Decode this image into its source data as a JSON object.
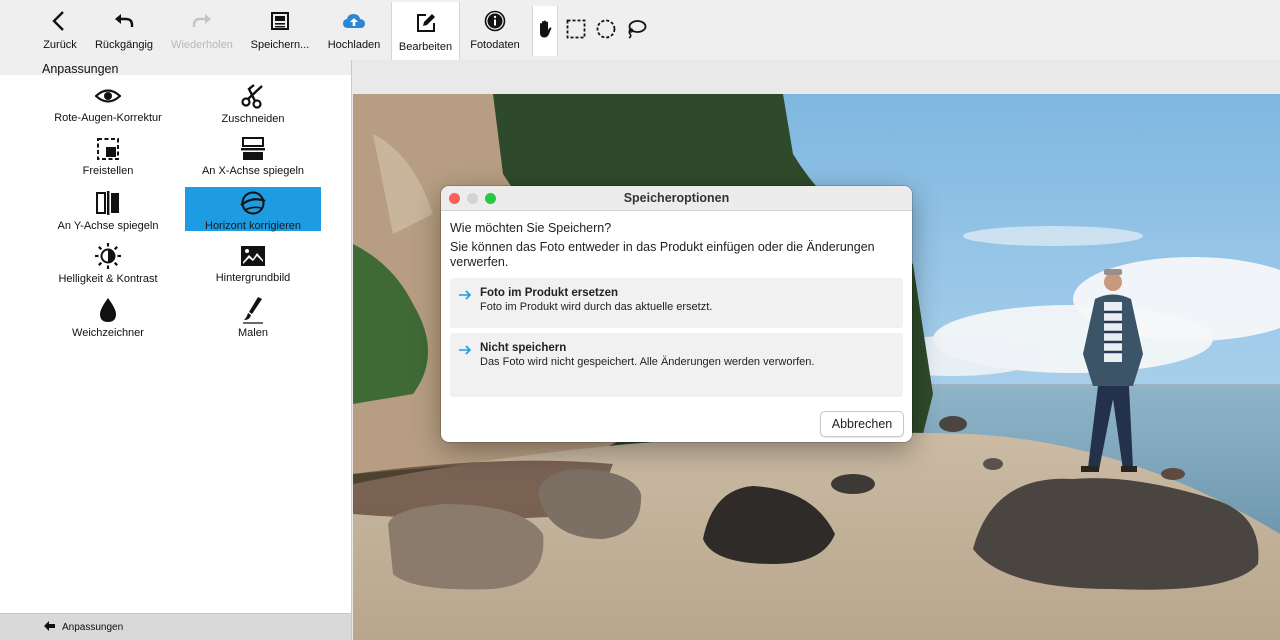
{
  "toolbar": {
    "buttons": [
      {
        "label": "Zurück",
        "icon": "chevron-left-icon"
      },
      {
        "label": "Rückgängig",
        "icon": "undo-icon"
      },
      {
        "label": "Wiederholen",
        "icon": "redo-icon"
      },
      {
        "label": "Speichern...",
        "icon": "save-icon"
      },
      {
        "label": "Hochladen",
        "icon": "cloud-upload-icon"
      },
      {
        "label": "Bearbeiten",
        "icon": "edit-icon"
      },
      {
        "label": "Fotodaten",
        "icon": "info-icon"
      }
    ],
    "tools": [
      "hand-tool-icon",
      "rect-select-icon",
      "ellipse-select-icon",
      "lasso-icon"
    ]
  },
  "panel": {
    "title": "Anpassungen",
    "items": [
      {
        "label": "Rote-Augen-Korrektur",
        "icon": "eye-icon"
      },
      {
        "label": "Zuschneiden",
        "icon": "scissors-icon"
      },
      {
        "label": "Freistellen",
        "icon": "crop-icon"
      },
      {
        "label": "An X-Achse spiegeln",
        "icon": "flip-x-icon"
      },
      {
        "label": "An Y-Achse spiegeln",
        "icon": "flip-y-icon"
      },
      {
        "label": "Horizont korrigieren",
        "icon": "horizon-icon"
      },
      {
        "label": "Helligkeit & Kontrast",
        "icon": "brightness-icon"
      },
      {
        "label": "Hintergrundbild",
        "icon": "image-icon"
      },
      {
        "label": "Weichzeichner",
        "icon": "drop-icon"
      },
      {
        "label": "Malen",
        "icon": "brush-icon"
      }
    ],
    "selected": "Horizont korrigieren",
    "footer_label": "Anpassungen"
  },
  "dialog": {
    "title": "Speicheroptionen",
    "question": "Wie möchten Sie Speichern?",
    "description": "Sie können das Foto entweder in das Produkt einfügen oder die Änderungen verwerfen.",
    "options": [
      {
        "title": "Foto im Produkt ersetzen",
        "subtitle": "Foto im Produkt wird durch das aktuelle ersetzt."
      },
      {
        "title": "Nicht speichern",
        "subtitle": "Das Foto wird nicht gespeichert. Alle Änderungen werden verworfen."
      }
    ],
    "cancel_label": "Abbrechen"
  },
  "colors": {
    "accent": "#1e9ce2",
    "upload_icon": "#2a86d6",
    "traffic_red": "#fe5f57",
    "traffic_yellow": "#d3d3d3",
    "traffic_green": "#28c840"
  }
}
